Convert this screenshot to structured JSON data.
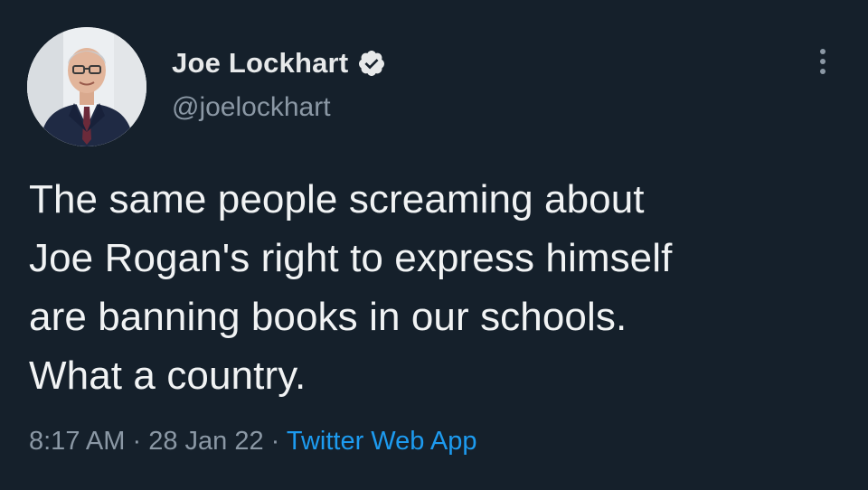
{
  "author": {
    "display_name": "Joe Lockhart",
    "handle": "@joelockhart",
    "verified": true,
    "avatar_icon": "profile-photo"
  },
  "tweet": {
    "lines": [
      "The same people screaming about",
      "Joe Rogan's right to express himself",
      "are banning books in our schools.",
      "What a country."
    ]
  },
  "meta": {
    "time": "8:17 AM",
    "separator1": " · ",
    "date": "28 Jan 22",
    "separator2": " · ",
    "source": "Twitter Web App"
  },
  "colors": {
    "background": "#15202b",
    "text": "#e7e9ea",
    "secondary": "#8b98a5",
    "accent": "#1d9bf0"
  },
  "icons": {
    "verified": "verified-badge-icon",
    "more": "more-options-icon"
  }
}
